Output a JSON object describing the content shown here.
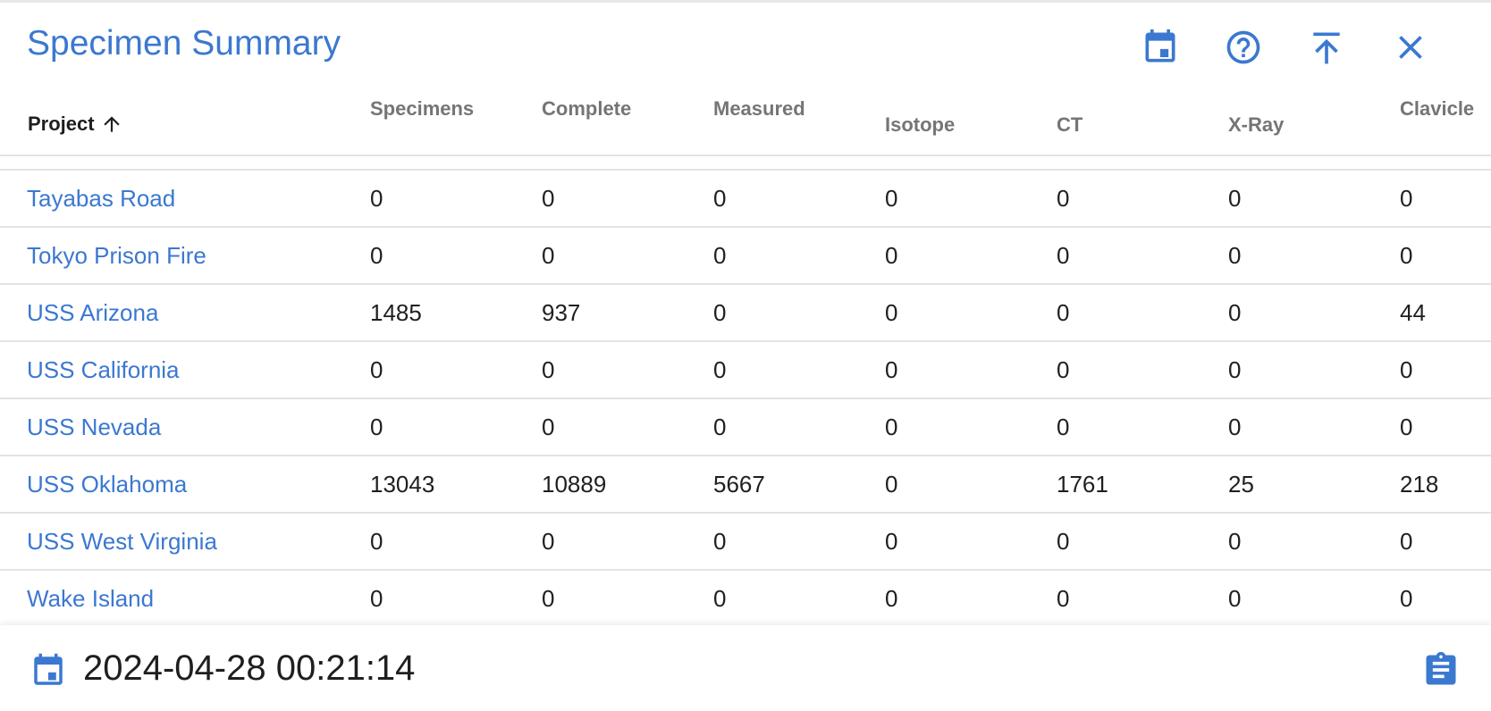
{
  "title": "Specimen Summary",
  "accent_color": "#3b78d0",
  "toolbar": {
    "icons": [
      "calendar-icon",
      "help-icon",
      "scroll-to-top-icon",
      "close-icon"
    ]
  },
  "table": {
    "project_header": "Project",
    "sort": "ascending",
    "headers": [
      "Specimens",
      "Complete",
      "Measured",
      "Isotope",
      "CT",
      "X-Ray",
      "Clavicle"
    ],
    "rows": [
      {
        "project": "Tayabas Road",
        "values": [
          "0",
          "0",
          "0",
          "0",
          "0",
          "0",
          "0"
        ]
      },
      {
        "project": "Tokyo Prison Fire",
        "values": [
          "0",
          "0",
          "0",
          "0",
          "0",
          "0",
          "0"
        ]
      },
      {
        "project": "USS Arizona",
        "values": [
          "1485",
          "937",
          "0",
          "0",
          "0",
          "0",
          "44"
        ]
      },
      {
        "project": "USS California",
        "values": [
          "0",
          "0",
          "0",
          "0",
          "0",
          "0",
          "0"
        ]
      },
      {
        "project": "USS Nevada",
        "values": [
          "0",
          "0",
          "0",
          "0",
          "0",
          "0",
          "0"
        ]
      },
      {
        "project": "USS Oklahoma",
        "values": [
          "13043",
          "10889",
          "5667",
          "0",
          "1761",
          "25",
          "218"
        ]
      },
      {
        "project": "USS West Virginia",
        "values": [
          "0",
          "0",
          "0",
          "0",
          "0",
          "0",
          "0"
        ]
      },
      {
        "project": "Wake Island",
        "values": [
          "0",
          "0",
          "0",
          "0",
          "0",
          "0",
          "0"
        ]
      }
    ]
  },
  "footer": {
    "timestamp": "2024-04-28 00:21:14",
    "icons": [
      "calendar-icon",
      "clipboard-icon"
    ]
  }
}
